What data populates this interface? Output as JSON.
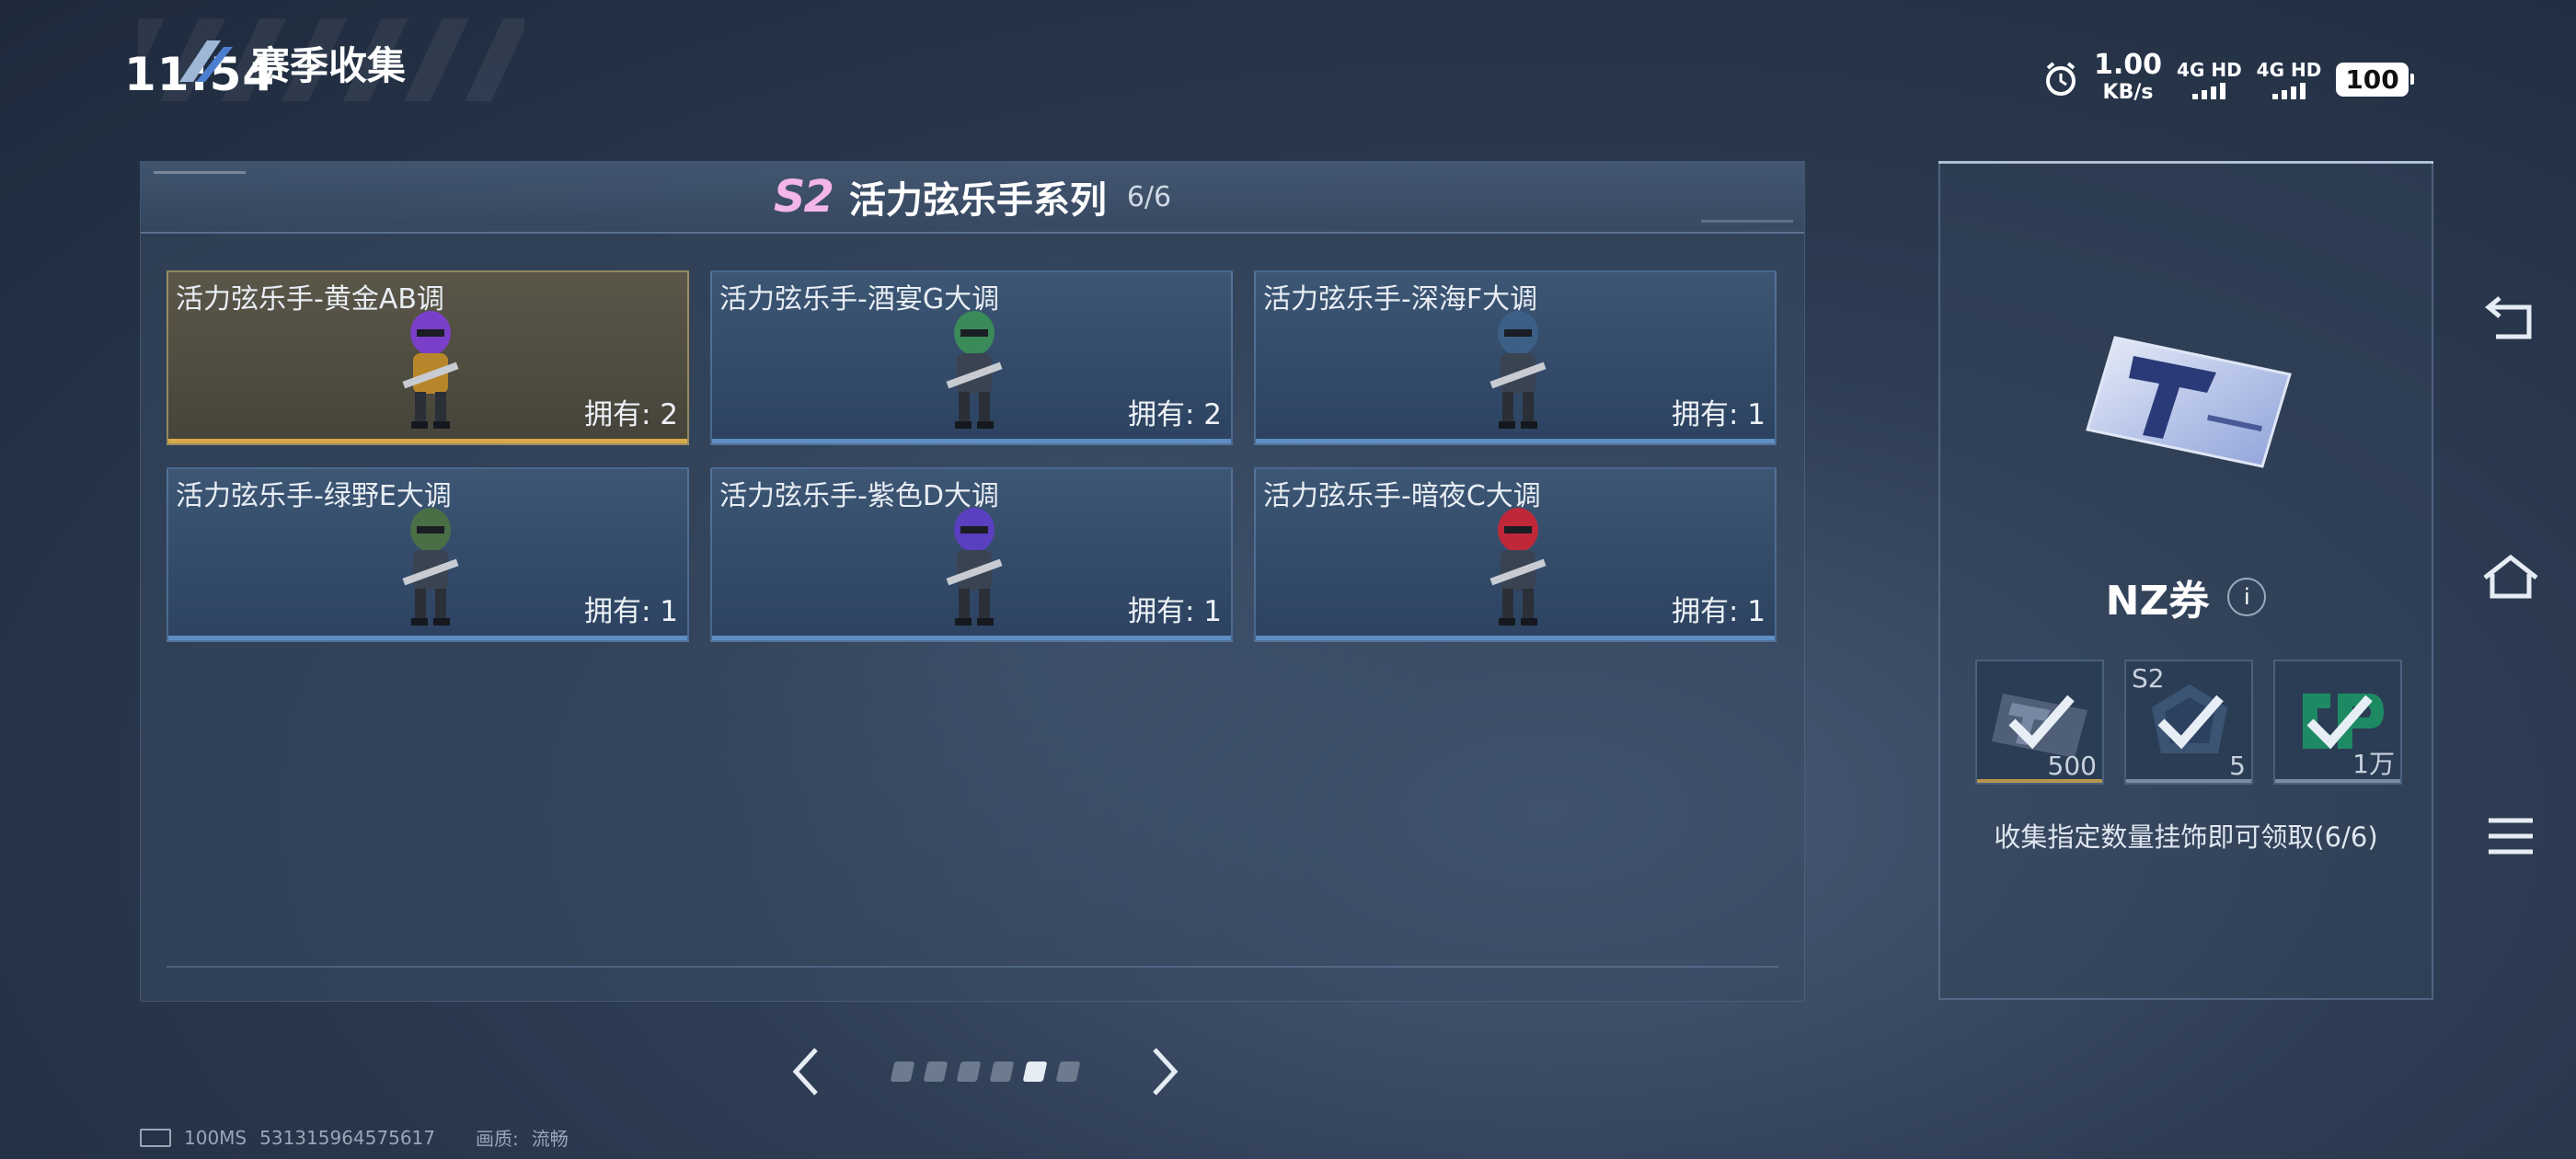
{
  "status_bar": {
    "time": "11:54",
    "net_rate_value": "1.00",
    "net_rate_unit": "KB/s",
    "sim1": "4G HD",
    "sim2": "4G HD",
    "battery": "100"
  },
  "header": {
    "title": "赛季收集"
  },
  "collection": {
    "season_badge": "S2",
    "series_name": "活力弦乐手系列",
    "progress": "6/6",
    "items": [
      {
        "name": "活力弦乐手-黄金AB调",
        "owned": "拥有: 2",
        "helmet_color": "#7a3fc9",
        "rarity": "gold"
      },
      {
        "name": "活力弦乐手-酒宴G大调",
        "owned": "拥有: 2",
        "helmet_color": "#3a8a5a",
        "rarity": "blue"
      },
      {
        "name": "活力弦乐手-深海F大调",
        "owned": "拥有: 1",
        "helmet_color": "#3c5f86",
        "rarity": "blue"
      },
      {
        "name": "活力弦乐手-绿野E大调",
        "owned": "拥有: 1",
        "helmet_color": "#4a6e46",
        "rarity": "blue"
      },
      {
        "name": "活力弦乐手-紫色D大调",
        "owned": "拥有: 1",
        "helmet_color": "#5a3fc0",
        "rarity": "blue"
      },
      {
        "name": "活力弦乐手-暗夜C大调",
        "owned": "拥有: 1",
        "helmet_color": "#c0283a",
        "rarity": "blue"
      }
    ]
  },
  "pager": {
    "page_count": 6,
    "active_index": 4
  },
  "reward_panel": {
    "reward_name": "NZ券",
    "info_label": "i",
    "rewards": [
      {
        "icon": "ticket-icon",
        "quantity": "500",
        "tag": "",
        "claimed": true
      },
      {
        "icon": "s2-badge-icon",
        "quantity": "5",
        "tag": "S2",
        "claimed": true
      },
      {
        "icon": "cp-coin-icon",
        "quantity": "1万",
        "tag": "",
        "claimed": true
      }
    ],
    "hint": "收集指定数量挂饰即可领取(6/6)"
  },
  "footer": {
    "latency": "100MS",
    "user_id": "531315964575617",
    "quality_label": "画质:",
    "quality_value": "流畅"
  },
  "colors": {
    "accent_gold": "#d7a94a",
    "accent_blue": "#5d8ec4",
    "season_pink": "#f3b6e6"
  },
  "side_nav": [
    "back-icon",
    "home-icon",
    "menu-icon"
  ]
}
